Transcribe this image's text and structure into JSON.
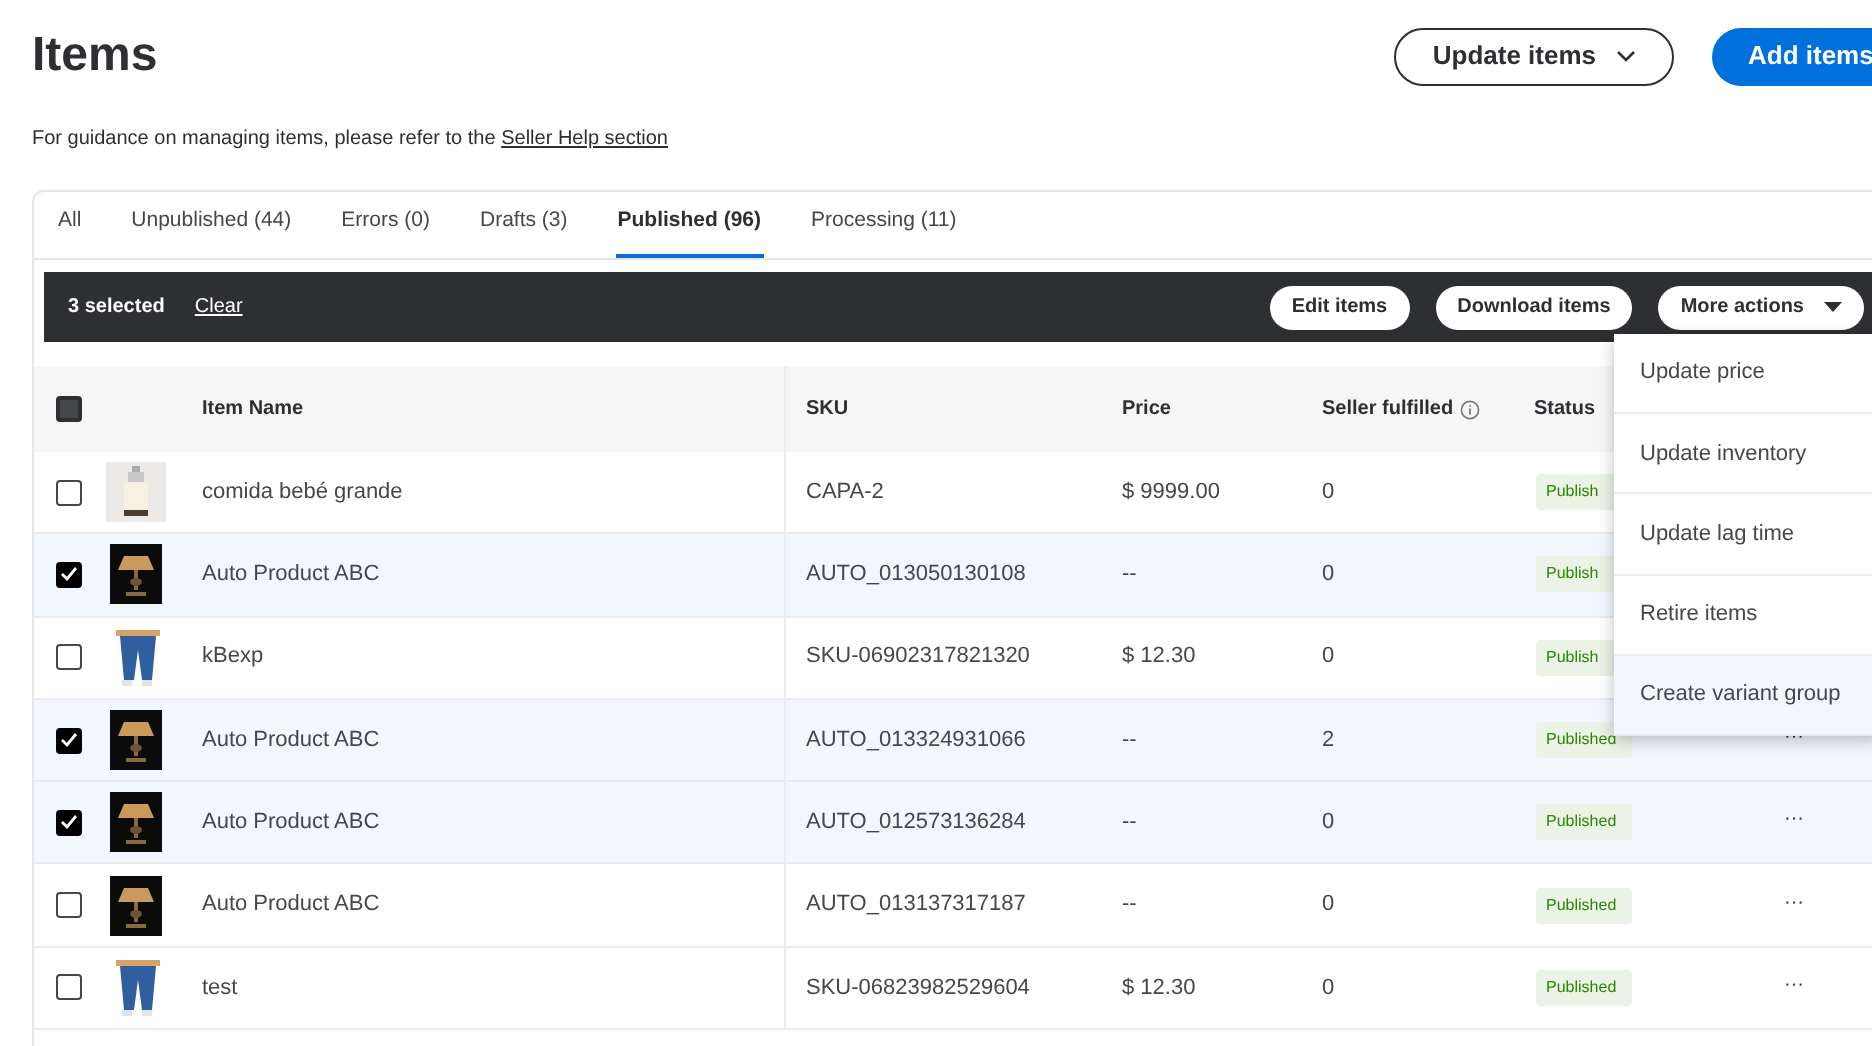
{
  "page": {
    "title": "Items",
    "guidance": "For guidance on managing items, please refer to the",
    "guidance_link": "Seller Help section"
  },
  "header_buttons": [
    {
      "label": "Update items",
      "kind": "outline"
    },
    {
      "label": "Add items",
      "kind": "primary"
    }
  ],
  "tabs": [
    {
      "label": "All",
      "selected": false
    },
    {
      "label": "Unpublished (44)",
      "selected": false
    },
    {
      "label": "Errors (0)",
      "selected": false
    },
    {
      "label": "Drafts (3)",
      "selected": false
    },
    {
      "label": "Published (96)",
      "selected": true
    },
    {
      "label": "Processing (11)",
      "selected": false
    }
  ],
  "action_bar": {
    "selected_count": "3 selected",
    "clear": "Clear",
    "buttons": [
      "Edit items",
      "Download items"
    ],
    "more": "More actions"
  },
  "table": {
    "select_all_indeterminate": true,
    "columns": [
      "Item Name",
      "SKU",
      "Price",
      "Seller fulfilled",
      "Status"
    ],
    "rows": [
      {
        "checked": false,
        "name": "comida bebé grande",
        "sku": "CAPA-2",
        "price": "$ 9999.00",
        "seller_fulfilled": "0",
        "status": "Publish"
      },
      {
        "checked": true,
        "name": "Auto Product ABC",
        "sku": "AUTO_013050130108",
        "price": "--",
        "seller_fulfilled": "0",
        "status": "Publish"
      },
      {
        "checked": false,
        "name": "kBexp",
        "sku": "SKU-06902317821320",
        "price": "$ 12.30",
        "seller_fulfilled": "0",
        "status": "Publish"
      },
      {
        "checked": true,
        "name": "Auto Product ABC",
        "sku": "AUTO_013324931066",
        "price": "--",
        "seller_fulfilled": "2",
        "status": "Published",
        "more": "···"
      },
      {
        "checked": true,
        "name": "Auto Product ABC",
        "sku": "AUTO_012573136284",
        "price": "--",
        "seller_fulfilled": "0",
        "status": "Published",
        "more": "···"
      },
      {
        "checked": false,
        "name": "Auto Product ABC",
        "sku": "AUTO_013137317187",
        "price": "--",
        "seller_fulfilled": "0",
        "status": "Published",
        "more": "···"
      },
      {
        "checked": false,
        "name": "test",
        "sku": "SKU-06823982529604",
        "price": "$ 12.30",
        "seller_fulfilled": "0",
        "status": "Published",
        "more": "···"
      }
    ]
  },
  "menu": {
    "items": [
      {
        "label": "Update price",
        "selected": false
      },
      {
        "label": "Update inventory",
        "selected": false
      },
      {
        "label": "Update lag time",
        "selected": false
      },
      {
        "label": "Retire items",
        "selected": false
      },
      {
        "label": "Create variant group",
        "selected": true
      }
    ]
  }
}
